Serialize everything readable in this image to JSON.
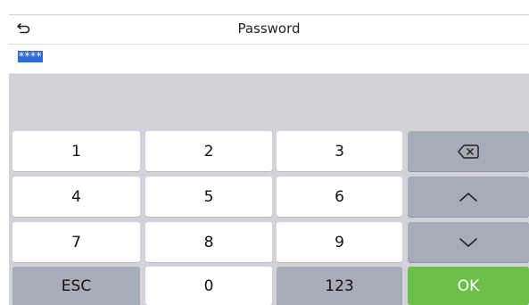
{
  "header": {
    "back_icon": "back-arrow-icon",
    "title": "Password"
  },
  "input": {
    "masked_value": "****"
  },
  "keypad": {
    "row1": [
      "1",
      "2",
      "3"
    ],
    "row2": [
      "4",
      "5",
      "6"
    ],
    "row3": [
      "7",
      "8",
      "9"
    ],
    "row4": [
      "ESC",
      "0",
      "123",
      "OK"
    ],
    "side_icons": [
      "backspace-icon",
      "chevron-up-icon",
      "chevron-down-icon"
    ]
  },
  "colors": {
    "ok_green": "#6cc04a",
    "func_key_gray": "#a7adb8",
    "selection_blue": "#2f6bd8"
  }
}
